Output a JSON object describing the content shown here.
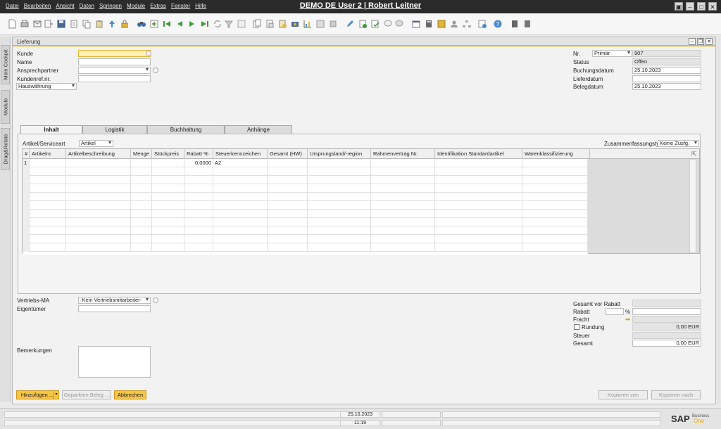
{
  "app": {
    "title": "DEMO DE User 2 | Robert Leitner",
    "menu": [
      "Datei",
      "Bearbeiten",
      "Ansicht",
      "Daten",
      "Springen",
      "Module",
      "Extras",
      "Fenster",
      "Hilfe"
    ]
  },
  "left_tabs": [
    "Mein Cockpit",
    "Module",
    "Drag&Relate"
  ],
  "document": {
    "title": "Lieferung",
    "header_left": {
      "kunde_label": "Kunde",
      "kunde_value": "",
      "name_label": "Name",
      "ansprechpartner_label": "Ansprechpartner",
      "kundenref_label": "Kundenref.nr.",
      "waehrung_value": "Hauswährung"
    },
    "header_right": {
      "nr_label": "Nr.",
      "series_value": "Primär",
      "nr_value": "907",
      "status_label": "Status",
      "status_value": "Offen",
      "buchungsdatum_label": "Buchungsdatum",
      "buchungsdatum_value": "25.10.2023",
      "lieferdatum_label": "Lieferdatum",
      "lieferdatum_value": "",
      "belegdatum_label": "Belegdatum",
      "belegdatum_value": "25.10.2023"
    },
    "tabs": [
      {
        "label": "Inhalt",
        "active": true
      },
      {
        "label": "Logistik",
        "active": false
      },
      {
        "label": "Buchhaltung",
        "active": false
      },
      {
        "label": "Anhänge",
        "active": false
      }
    ],
    "inhalt": {
      "artikel_label": "Artikel/Serviceart",
      "artikel_value": "Artikel",
      "zusammenfassung_label": "Zusammenfassungstyp",
      "zusammenfassung_value": "Keine Zusfg."
    },
    "grid": {
      "columns": [
        "#",
        "Artikelnr.",
        "Artikelbeschreibung",
        "Menge",
        "Stückpreis",
        "Rabatt %",
        "Steuerkennzeichen",
        "Gesamt (HW)",
        "Ursprungsland/-region",
        "Rahmenvertrag Nr.",
        "Identifikation Standardartikel",
        "Warenklassifizierung"
      ],
      "rows": [
        [
          "1",
          "",
          "",
          "",
          "",
          "0,0000",
          "A2",
          "",
          "",
          "",
          "",
          ""
        ]
      ]
    },
    "footer_left": {
      "vertriebs_label": "Vertriebs-MA",
      "vertriebs_value": "-Kein Vertriebsmitarbeiter-",
      "eigentuemer_label": "Eigentümer",
      "bemerkungen_label": "Bemerkungen"
    },
    "totals": {
      "gesamt_vor_rabatt_label": "Gesamt vor Rabatt",
      "gesamt_vor_rabatt_value": "",
      "rabatt_label": "Rabatt",
      "rabatt_percent_sign": "%",
      "fracht_label": "Fracht",
      "rundung_label": "Rundung",
      "rundung_value": "0,00 EUR",
      "steuer_label": "Steuer",
      "gesamt_label": "Gesamt",
      "gesamt_value": "0,00 EUR"
    },
    "buttons": {
      "hinzufuegen": "Hinzufügen ...",
      "geparkten": "Geparkten Beleg ...",
      "abbrechen": "Abbrechen",
      "kopieren_von": "Kopieren von",
      "kopieren_nach": "Kopieren nach"
    }
  },
  "statusbar": {
    "date": "25.10.2023",
    "time": "11:19",
    "logo_text": "SAP",
    "logo_sub_1": "Business",
    "logo_sub_2": "One"
  },
  "colors": {
    "accent": "#f6c543",
    "titlebar": "#2b2b2b",
    "mandatory_field": "#fff2b8"
  }
}
